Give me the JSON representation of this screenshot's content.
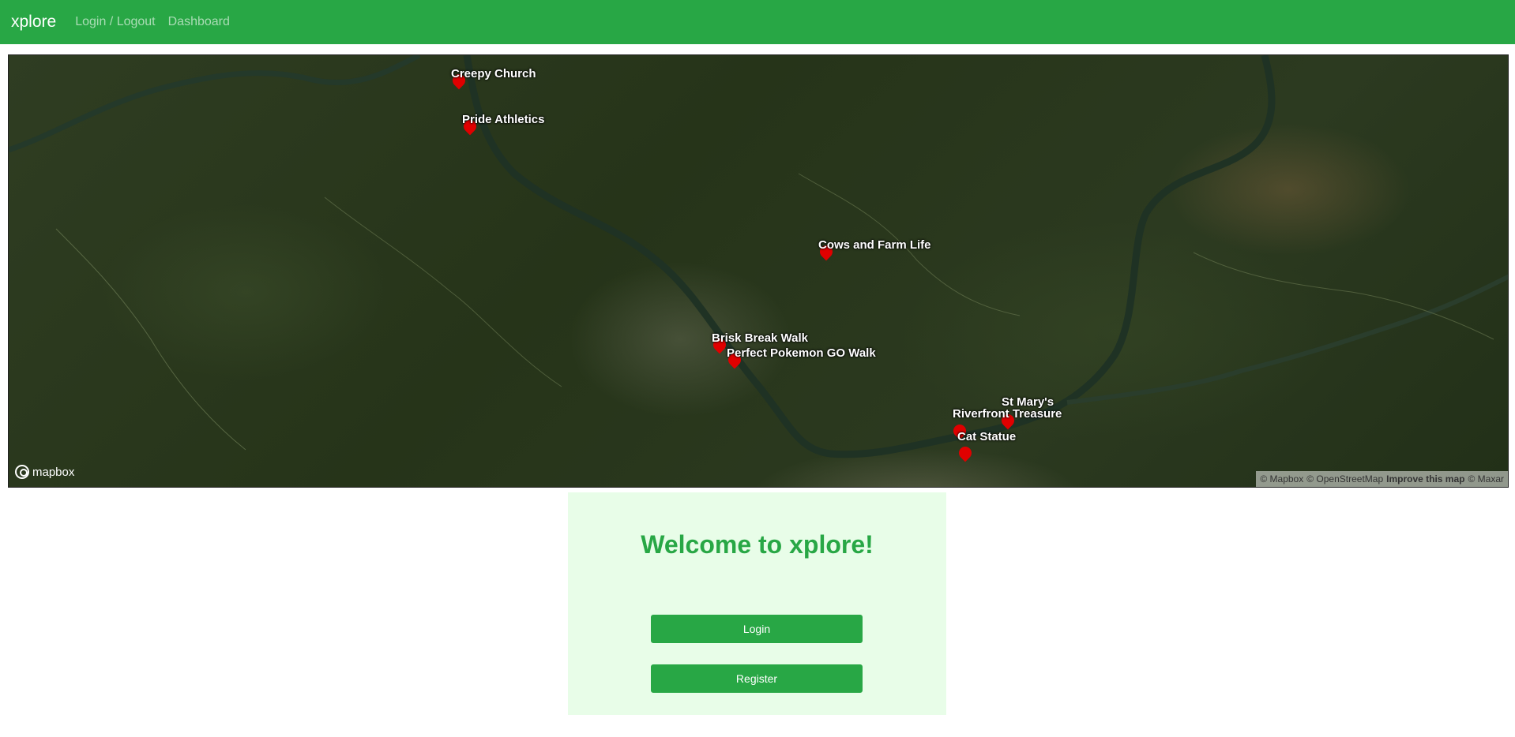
{
  "navbar": {
    "brand": "xplore",
    "links": [
      "Login / Logout",
      "Dashboard"
    ]
  },
  "map": {
    "markers": [
      {
        "label": "Creepy Church"
      },
      {
        "label": "Pride Athletics"
      },
      {
        "label": "Cows and Farm Life"
      },
      {
        "label": "Brisk Break Walk"
      },
      {
        "label": "Perfect Pokemon GO Walk"
      },
      {
        "label": "St Mary's"
      },
      {
        "label": "Riverfront Treasure"
      },
      {
        "label": "Cat Statue"
      }
    ],
    "logo": "mapbox",
    "attribution": {
      "mapbox": "© Mapbox",
      "osm": "© OpenStreetMap",
      "improve": "Improve this map",
      "maxar": "© Maxar"
    }
  },
  "welcome": {
    "title": "Welcome to xplore!",
    "login_label": "Login",
    "register_label": "Register"
  },
  "colors": {
    "brand_green": "#28a745",
    "card_bg": "#e8fde8",
    "marker_red": "#e00000"
  }
}
